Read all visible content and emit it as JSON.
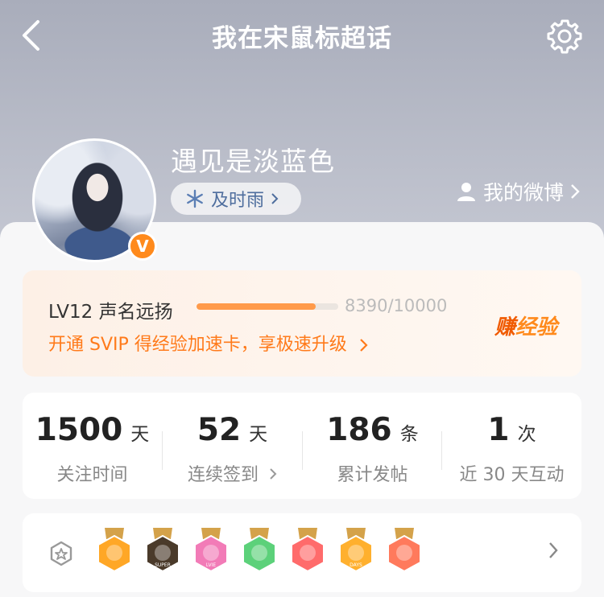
{
  "header": {
    "title": "我在宋鼠标超话"
  },
  "profile": {
    "username": "遇见是淡蓝色",
    "tag": "及时雨",
    "weibo_link": "我的微博",
    "badge_letter": "V"
  },
  "level": {
    "title": "LV12 声名远扬",
    "progress_text": "8390/10000",
    "progress_fraction": 0.839,
    "promo": "开通 SVIP 得经验加速卡，享极速升级",
    "earn_part1": "赚",
    "earn_part2": "经验"
  },
  "stats": [
    {
      "value": "1500",
      "unit": "天",
      "label": "关注时间"
    },
    {
      "value": "52",
      "unit": "天",
      "label": "连续签到"
    },
    {
      "value": "186",
      "unit": "条",
      "label": "累计发帖"
    },
    {
      "value": "1",
      "unit": "次",
      "label": "近 30 天互动"
    }
  ],
  "badges": [
    {
      "icon": "crown-badge-icon",
      "color": "#ffa726",
      "text": ""
    },
    {
      "icon": "super-crown-badge-icon",
      "color": "#4a3a2a",
      "text": "SUPER"
    },
    {
      "icon": "love-badge-icon",
      "color": "#f27bb7",
      "text": "LVIE"
    },
    {
      "icon": "hand-badge-icon",
      "color": "#5cd17a",
      "text": ""
    },
    {
      "icon": "trophy-badge-icon",
      "color": "#ff6b6b",
      "text": ""
    },
    {
      "icon": "30-days-badge-icon",
      "color": "#ffb02e",
      "text": "DAYS"
    },
    {
      "icon": "rock-hand-badge-icon",
      "color": "#ff7a5c",
      "text": ""
    }
  ],
  "colors": {
    "accent": "#ff8a1c",
    "promo_text": "#ff7a1a",
    "progress": "#ff9a4a"
  }
}
